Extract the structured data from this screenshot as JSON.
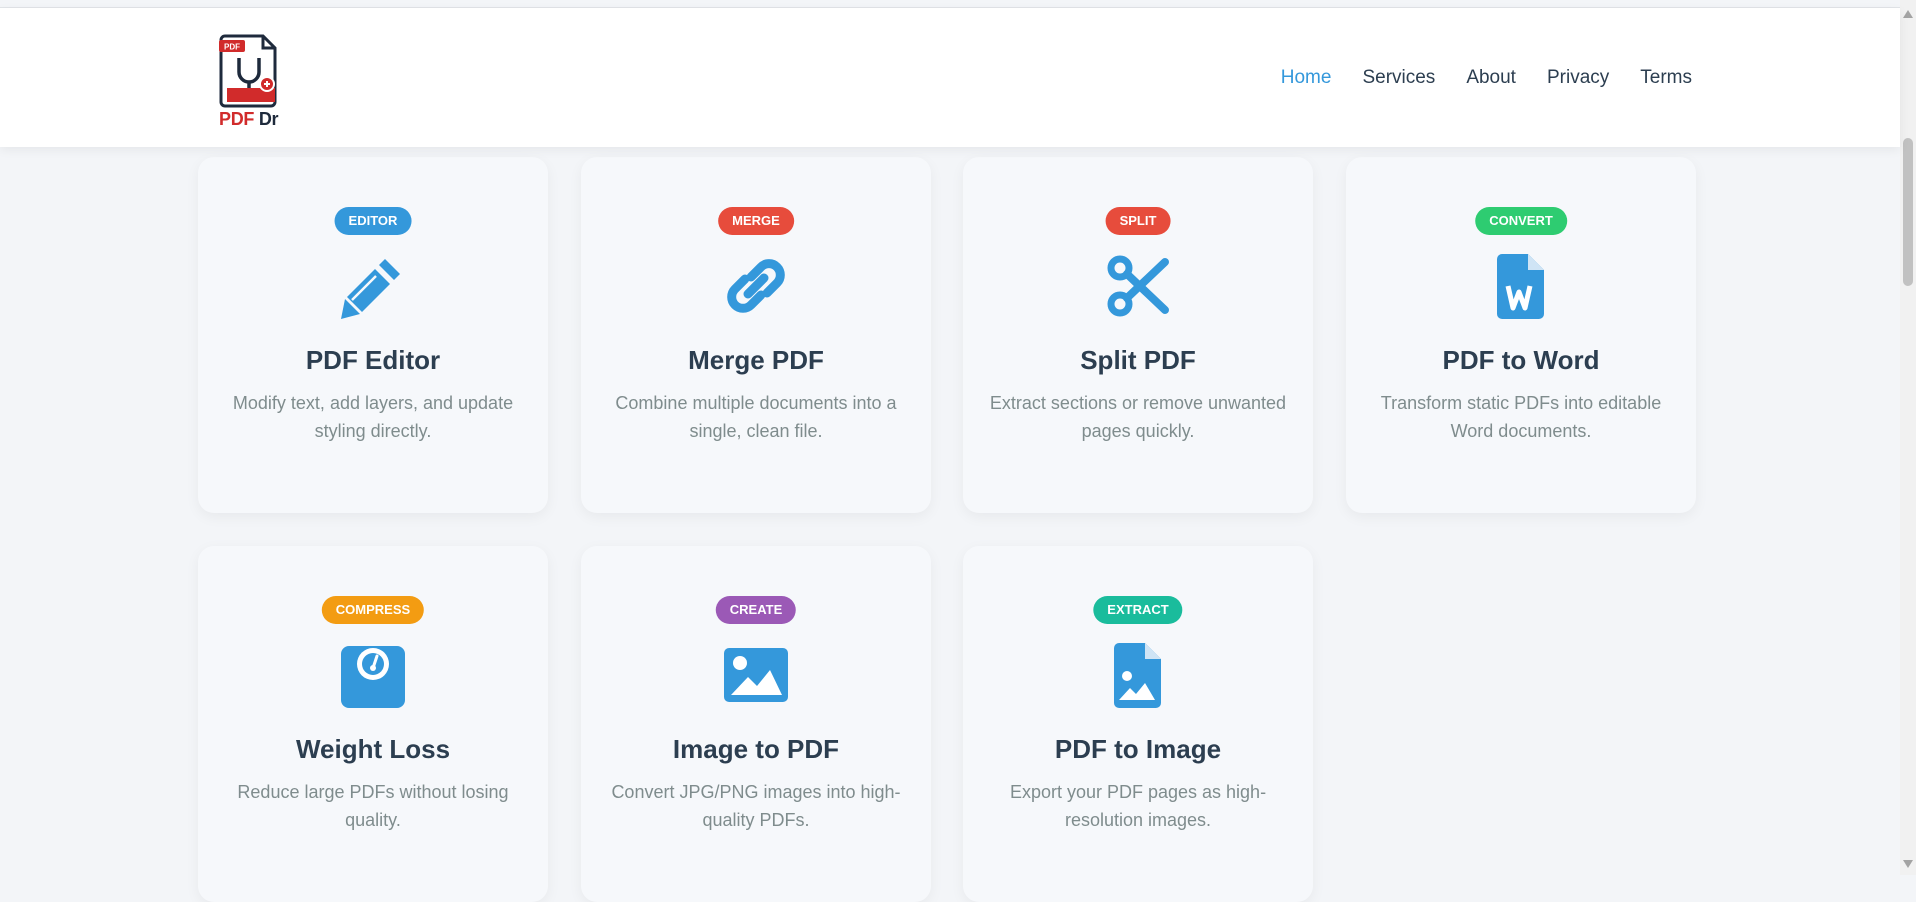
{
  "brand": {
    "logo_text_red": "PDF",
    "logo_text_dark": "Dr",
    "logo_badge": "PDF"
  },
  "nav": {
    "items": [
      {
        "label": "Home",
        "active": true
      },
      {
        "label": "Services",
        "active": false
      },
      {
        "label": "About",
        "active": false
      },
      {
        "label": "Privacy",
        "active": false
      },
      {
        "label": "Terms",
        "active": false
      }
    ],
    "active_color": "#3498db"
  },
  "cards": [
    {
      "badge": "EDITOR",
      "badge_color": "#3498db",
      "icon": "pencil-icon",
      "title": "PDF Editor",
      "description": "Modify text, add layers, and update styling directly."
    },
    {
      "badge": "MERGE",
      "badge_color": "#e74c3c",
      "icon": "link-icon",
      "title": "Merge PDF",
      "description": "Combine multiple documents into a single, clean file."
    },
    {
      "badge": "SPLIT",
      "badge_color": "#e74c3c",
      "icon": "scissors-icon",
      "title": "Split PDF",
      "description": "Extract sections or remove unwanted pages quickly."
    },
    {
      "badge": "CONVERT",
      "badge_color": "#2ecc71",
      "icon": "word-file-icon",
      "title": "PDF to Word",
      "description": "Transform static PDFs into editable Word documents."
    },
    {
      "badge": "COMPRESS",
      "badge_color": "#f39c12",
      "icon": "weight-scale-icon",
      "title": "Weight Loss",
      "description": "Reduce large PDFs without losing quality."
    },
    {
      "badge": "CREATE",
      "badge_color": "#9b59b6",
      "icon": "image-icon",
      "title": "Image to PDF",
      "description": "Convert JPG/PNG images into high-quality PDFs."
    },
    {
      "badge": "EXTRACT",
      "badge_color": "#1abc9c",
      "icon": "image-file-icon",
      "title": "PDF to Image",
      "description": "Export your PDF pages as high-resolution images."
    }
  ],
  "icon_color": "#3498db"
}
